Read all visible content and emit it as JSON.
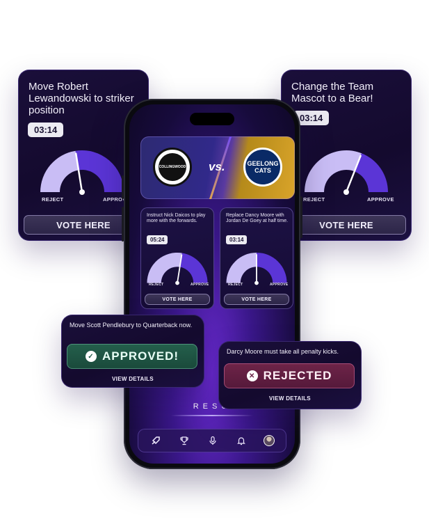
{
  "cards": {
    "left": {
      "title": "Move Robert Lewandowski to striker position",
      "timer": "03:14",
      "reject_label": "REJECT",
      "approve_label": "APPROVE",
      "vote_label": "VOTE HERE",
      "approve_share": 0.45
    },
    "right": {
      "title": "Change the Team Mascot to a Bear!",
      "timer": "03:14",
      "reject_label": "REJECT",
      "approve_label": "APPROVE",
      "vote_label": "VOTE HERE",
      "approve_share": 0.62
    }
  },
  "phone": {
    "match": {
      "home_logo_text": "COLLINGWOOD",
      "vs_label": "vs.",
      "away_logo_text": "GEELONG CATS"
    },
    "polls": [
      {
        "title": "Instruct Nick Daicos to play more with the forwards.",
        "timer": "05:24",
        "reject_label": "REJECT",
        "approve_label": "APPROVE",
        "vote_label": "VOTE HERE",
        "approve_share": 0.55
      },
      {
        "title": "Replace Dancy Moore with Jordan De Goey at half time.",
        "timer": "03:14",
        "reject_label": "REJECT",
        "approve_label": "APPROVE",
        "vote_label": "VOTE HERE",
        "approve_share": 0.5
      }
    ],
    "results_label": "RESU",
    "tabs": [
      "rocket-icon",
      "trophy-icon",
      "microphone-icon",
      "bell-icon",
      "avatar"
    ]
  },
  "results": {
    "approved": {
      "title": "Move Scott Pendlebury to Quarterback now.",
      "status": "APPROVED!",
      "details_label": "VIEW DETAILS"
    },
    "rejected": {
      "title": "Darcy Moore must take all penalty kicks.",
      "status": "REJECTED",
      "details_label": "VIEW DETAILS"
    }
  },
  "colors": {
    "gauge_light": "#c9bdf5",
    "gauge_dark": "#5b35d6",
    "approved_bg": "#1f5a47",
    "rejected_bg": "#6b2448"
  }
}
